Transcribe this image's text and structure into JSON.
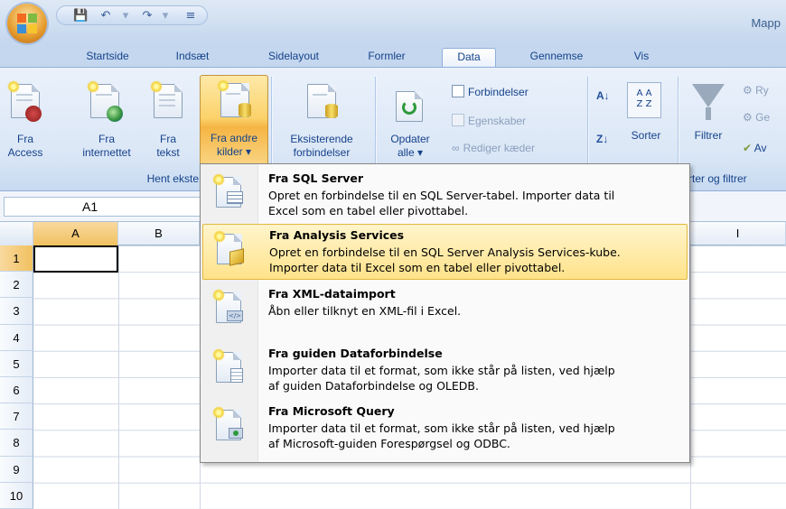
{
  "window": {
    "title": "Mapp"
  },
  "quick_access": {
    "items": [
      "save-icon",
      "undo-icon",
      "redo-icon",
      "customize-icon"
    ]
  },
  "tabs": [
    {
      "label": "Startside"
    },
    {
      "label": "Indsæt"
    },
    {
      "label": "Sidelayout"
    },
    {
      "label": "Formler"
    },
    {
      "label": "Data",
      "active": true
    },
    {
      "label": "Gennemse"
    },
    {
      "label": "Vis"
    }
  ],
  "ribbon": {
    "get_external": {
      "group_label": "Hent ekste",
      "fra_access": {
        "line1": "Fra",
        "line2": "Access"
      },
      "fra_internettet": {
        "line1": "Fra",
        "line2": "internettet"
      },
      "fra_tekst": {
        "line1": "Fra",
        "line2": "tekst"
      },
      "fra_andre": {
        "line1": "Fra andre",
        "line2": "kilder ▾"
      }
    },
    "existing": {
      "line1": "Eksisterende",
      "line2": "forbindelser"
    },
    "connections": {
      "opdater": {
        "line1": "Opdater",
        "line2": "alle ▾"
      },
      "forbindelser": "Forbindelser",
      "egenskaber": "Egenskaber",
      "rediger": "Rediger kæder"
    },
    "sort_filter": {
      "sorter": "Sorter",
      "filtrer": "Filtrer",
      "ry": "Ry",
      "ge": "Ge",
      "av": "Av",
      "group_label": "rter og filtrer"
    }
  },
  "formula_bar": {
    "name_box": "A1"
  },
  "columns": [
    "A",
    "B",
    "I"
  ],
  "rows": [
    "1",
    "2",
    "3",
    "4",
    "5",
    "6",
    "7",
    "8",
    "9",
    "10"
  ],
  "menu": {
    "items": [
      {
        "title": "Fra SQL Server",
        "desc1": "Opret en forbindelse til en SQL Server-tabel. Importer data til",
        "desc2": "Excel som en tabel eller pivottabel."
      },
      {
        "title": "Fra Analysis Services",
        "desc1": "Opret en forbindelse til en SQL Server Analysis Services-kube.",
        "desc2": "Importer data til Excel som en tabel eller pivottabel."
      },
      {
        "title": "Fra XML-dataimport",
        "desc1": "Åbn eller tilknyt en XML-fil i Excel.",
        "desc2": ""
      },
      {
        "title": "Fra guiden Dataforbindelse",
        "desc1": "Importer data til et format, som ikke står på listen, ved hjælp",
        "desc2": "af guiden Dataforbindelse og OLEDB."
      },
      {
        "title": "Fra Microsoft Query",
        "desc1": "Importer data til et format, som ikke står på listen, ved hjælp",
        "desc2": "af Microsoft-guiden Forespørgsel og ODBC."
      }
    ]
  }
}
